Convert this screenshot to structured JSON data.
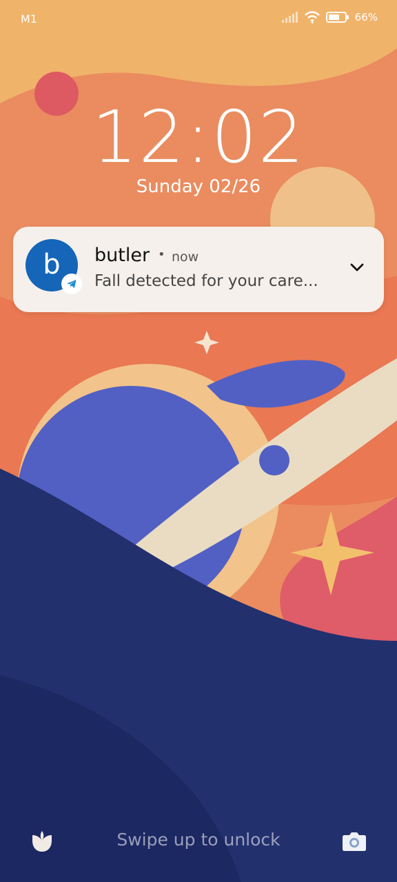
{
  "status_bar": {
    "carrier": "M1",
    "battery_percent": "66%",
    "icons": [
      "signal-icon",
      "wifi-icon",
      "battery-icon"
    ]
  },
  "lockscreen": {
    "time": "12:02",
    "date": "Sunday 02/26"
  },
  "notification": {
    "avatar_letter": "b",
    "app_name": "butler",
    "separator": "•",
    "time": "now",
    "text": "Fall detected for your care...",
    "badge_icon": "telegram-icon",
    "expand_icon": "chevron-down-icon"
  },
  "bottom": {
    "unlock_hint": "Swipe up to unlock",
    "left_icon": "flower-shortcut-icon",
    "right_icon": "camera-icon"
  },
  "colors": {
    "avatar": "#1565b8",
    "card": "#f6f0ec",
    "planet": "#5260c4",
    "hill": "#23306e"
  }
}
